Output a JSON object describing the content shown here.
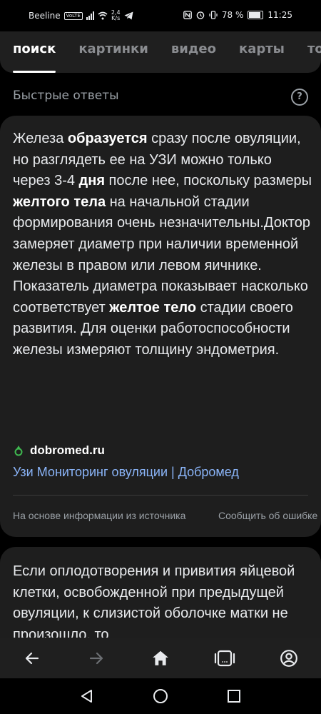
{
  "status_bar": {
    "carrier": "Beeline",
    "volte": "VoLTE",
    "speed_value": "2,4",
    "speed_unit": "K/s",
    "battery": "78 %",
    "time": "11:25"
  },
  "tabs": [
    {
      "label": "поиск",
      "active": true
    },
    {
      "label": "картинки",
      "active": false
    },
    {
      "label": "видео",
      "active": false
    },
    {
      "label": "карты",
      "active": false
    },
    {
      "label": "товары",
      "active": false
    }
  ],
  "section": {
    "title": "Быстрые ответы",
    "help_icon": "question-circle-icon"
  },
  "answer": {
    "segments": [
      {
        "text": "Железа ",
        "bold": false
      },
      {
        "text": "образуется",
        "bold": true
      },
      {
        "text": " сразу после овуляции, но разглядеть ее на УЗИ можно только через 3-4 ",
        "bold": false
      },
      {
        "text": "дня",
        "bold": true
      },
      {
        "text": " после нее, поскольку размеры ",
        "bold": false
      },
      {
        "text": "желтого тела",
        "bold": true
      },
      {
        "text": " на начальной стадии формирования очень незначительны.Доктор замеряет диаметр при наличии временной железы в правом или левом яичнике. Показатель диаметра показывает насколько соответствует ",
        "bold": false
      },
      {
        "text": "желтое тело",
        "bold": true
      },
      {
        "text": " стадии своего развития. Для оценки работоспособности железы измеряют толщину эндометрия.",
        "bold": false
      }
    ],
    "source_domain": "dobromed.ru",
    "source_icon": "dobromed-logo-icon",
    "source_link": "Узи Мониторинг овуляции | Добромед",
    "footer_note": "На основе информации из источника",
    "report_link": "Сообщить об ошибке"
  },
  "answer2": {
    "text": "Если оплодотворения и привития яйцевой клетки, освобожденной при предыдущей овуляции, к слизистой оболочке матки не произошло, то"
  },
  "toolbar": {
    "back": "arrow-left-icon",
    "forward": "arrow-right-icon",
    "home": "home-icon",
    "tabs": "tabs-icon",
    "profile": "profile-icon"
  },
  "system_nav": {
    "back": "triangle-back-icon",
    "home": "circle-home-icon",
    "recents": "square-recents-icon"
  },
  "colors": {
    "background": "#000000",
    "card": "#1e1e1e",
    "link": "#8ab4f8",
    "muted": "#9aa0a6",
    "accent_green": "#3fb950"
  }
}
